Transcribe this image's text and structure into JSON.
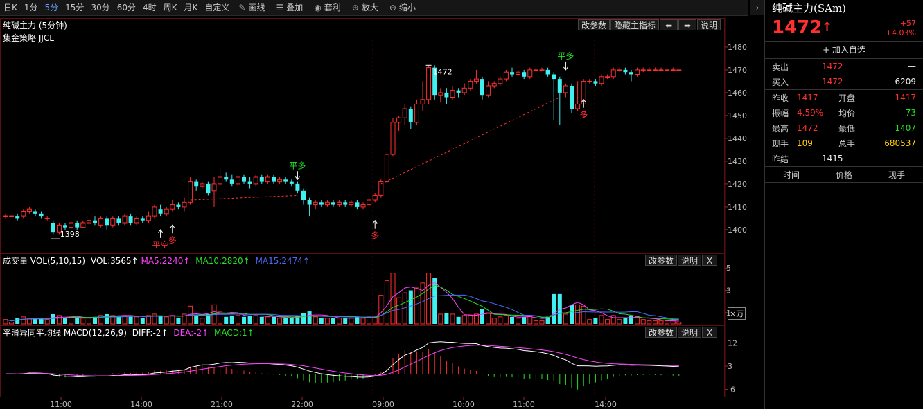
{
  "toolbar": {
    "timeframes": [
      "日K",
      "1分",
      "5分",
      "15分",
      "30分",
      "60分",
      "4时",
      "周K",
      "月K",
      "自定义"
    ],
    "active_timeframe": "5分",
    "tools": [
      {
        "label": "画线",
        "icon": "pencil-icon"
      },
      {
        "label": "叠加",
        "icon": "layers-icon"
      },
      {
        "label": "套利",
        "icon": "money-bag-icon"
      },
      {
        "label": "放大",
        "icon": "zoom-in-icon"
      },
      {
        "label": "缩小",
        "icon": "zoom-out-icon"
      }
    ]
  },
  "main_pane": {
    "title": "纯碱主力 (5分钟)",
    "strategy": "集金策略 JJCL",
    "buttons": {
      "params": "改参数",
      "hide": "隐藏主指标",
      "help": "说明"
    },
    "y_ticks": [
      "1480",
      "1470",
      "1460",
      "1450",
      "1440",
      "1430",
      "1420",
      "1410",
      "1400"
    ],
    "annotations": {
      "high": "1472",
      "low": "1398"
    },
    "signals": [
      {
        "text": "平空",
        "color": "#ff3030"
      },
      {
        "text": "多",
        "color": "#ff3030"
      },
      {
        "text": "平多",
        "color": "#22e022"
      },
      {
        "text": "多",
        "color": "#ff3030"
      },
      {
        "text": "平多",
        "color": "#22e022"
      },
      {
        "text": "多",
        "color": "#ff3030"
      }
    ]
  },
  "volume_pane": {
    "label": "成交量 VOL(5,10,15)",
    "vol": "VOL:3565↑",
    "ma5": "MA5:2240↑",
    "ma10": "MA10:2820↑",
    "ma15": "MA15:2474↑",
    "buttons": {
      "params": "改参数",
      "help": "说明",
      "close": "X"
    },
    "y_ticks": [
      "5",
      "3",
      "1"
    ],
    "unit": "×万"
  },
  "macd_pane": {
    "label": "平滑异同平均线 MACD(12,26,9)",
    "diff": "DIFF:-2↑",
    "dea": "DEA:-2↑",
    "macd": "MACD:1↑",
    "buttons": {
      "params": "改参数",
      "help": "说明",
      "close": "X"
    },
    "y_ticks": [
      "12",
      "3",
      "-6"
    ]
  },
  "x_axis": [
    "11:00",
    "14:00",
    "21:00",
    "22:00",
    "09:00",
    "10:00",
    "11:00",
    "14:00"
  ],
  "chart_data": {
    "type": "candlestick",
    "ylim": [
      1393,
      1483
    ],
    "candles": [
      [
        1406,
        1406,
        1407,
        1405
      ],
      [
        1406,
        1406,
        1406,
        1406
      ],
      [
        1406,
        1405,
        1407,
        1404
      ],
      [
        1406,
        1408,
        1409,
        1405
      ],
      [
        1408,
        1409,
        1410,
        1407
      ],
      [
        1408,
        1407,
        1409,
        1406
      ],
      [
        1407,
        1406,
        1408,
        1405
      ],
      [
        1405,
        1405,
        1406,
        1404
      ],
      [
        1403,
        1399,
        1404,
        1398
      ],
      [
        1399,
        1402,
        1403,
        1398
      ],
      [
        1402,
        1401,
        1403,
        1400
      ],
      [
        1401,
        1403,
        1404,
        1400
      ],
      [
        1403,
        1401,
        1404,
        1400
      ],
      [
        1401,
        1403,
        1404,
        1401
      ],
      [
        1403,
        1404,
        1405,
        1402
      ],
      [
        1404,
        1403,
        1406,
        1402
      ],
      [
        1402,
        1405,
        1406,
        1401
      ],
      [
        1405,
        1402,
        1406,
        1400
      ],
      [
        1402,
        1405,
        1406,
        1401
      ],
      [
        1405,
        1403,
        1406,
        1402
      ],
      [
        1403,
        1406,
        1407,
        1402
      ],
      [
        1406,
        1403,
        1407,
        1402
      ],
      [
        1403,
        1405,
        1406,
        1402
      ],
      [
        1405,
        1404,
        1406,
        1403
      ],
      [
        1404,
        1406,
        1408,
        1403
      ],
      [
        1406,
        1410,
        1411,
        1405
      ],
      [
        1409,
        1407,
        1411,
        1406
      ],
      [
        1407,
        1409,
        1410,
        1406
      ],
      [
        1409,
        1411,
        1413,
        1408
      ],
      [
        1411,
        1410,
        1412,
        1409
      ],
      [
        1410,
        1412,
        1414,
        1408
      ],
      [
        1412,
        1421,
        1423,
        1411
      ],
      [
        1421,
        1419,
        1422,
        1417
      ],
      [
        1419,
        1420,
        1421,
        1418
      ],
      [
        1420,
        1416,
        1421,
        1415
      ],
      [
        1417,
        1420,
        1423,
        1410
      ],
      [
        1420,
        1423,
        1427,
        1419
      ],
      [
        1423,
        1422,
        1425,
        1421
      ],
      [
        1422,
        1420,
        1424,
        1419
      ],
      [
        1420,
        1423,
        1424,
        1419
      ],
      [
        1423,
        1421,
        1424,
        1420
      ],
      [
        1421,
        1420,
        1423,
        1418
      ],
      [
        1420,
        1423,
        1424,
        1419
      ],
      [
        1423,
        1421,
        1424,
        1420
      ],
      [
        1421,
        1423,
        1424,
        1420
      ],
      [
        1423,
        1421,
        1424,
        1420
      ],
      [
        1421,
        1422,
        1423,
        1420
      ],
      [
        1422,
        1421,
        1423,
        1420
      ],
      [
        1421,
        1420,
        1422,
        1419
      ],
      [
        1420,
        1417,
        1421,
        1416
      ],
      [
        1417,
        1413,
        1418,
        1411
      ],
      [
        1413,
        1411,
        1414,
        1406
      ],
      [
        1411,
        1412,
        1413,
        1409
      ],
      [
        1412,
        1411,
        1413,
        1410
      ],
      [
        1411,
        1412,
        1413,
        1410
      ],
      [
        1412,
        1411,
        1413,
        1410
      ],
      [
        1411,
        1412,
        1413,
        1410
      ],
      [
        1412,
        1411,
        1413,
        1410
      ],
      [
        1411,
        1412,
        1413,
        1410
      ],
      [
        1412,
        1410,
        1413,
        1409
      ],
      [
        1410,
        1411,
        1412,
        1409
      ],
      [
        1411,
        1413,
        1414,
        1410
      ],
      [
        1413,
        1415,
        1416,
        1412
      ],
      [
        1415,
        1421,
        1422,
        1414
      ],
      [
        1421,
        1433,
        1434,
        1420
      ],
      [
        1433,
        1447,
        1449,
        1432
      ],
      [
        1447,
        1449,
        1450,
        1443
      ],
      [
        1449,
        1453,
        1455,
        1446
      ],
      [
        1453,
        1447,
        1454,
        1444
      ],
      [
        1447,
        1455,
        1457,
        1446
      ],
      [
        1455,
        1457,
        1465,
        1452
      ],
      [
        1457,
        1471,
        1472,
        1455
      ],
      [
        1471,
        1459,
        1472,
        1457
      ],
      [
        1459,
        1460,
        1462,
        1456
      ],
      [
        1460,
        1458,
        1462,
        1455
      ],
      [
        1458,
        1461,
        1463,
        1457
      ],
      [
        1461,
        1460,
        1462,
        1458
      ],
      [
        1460,
        1462,
        1464,
        1459
      ],
      [
        1462,
        1465,
        1466,
        1461
      ],
      [
        1465,
        1466,
        1470,
        1464
      ],
      [
        1466,
        1459,
        1467,
        1457
      ],
      [
        1459,
        1463,
        1465,
        1458
      ],
      [
        1463,
        1464,
        1465,
        1462
      ],
      [
        1464,
        1466,
        1467,
        1463
      ],
      [
        1466,
        1469,
        1470,
        1465
      ],
      [
        1469,
        1468,
        1471,
        1467
      ],
      [
        1468,
        1469,
        1470,
        1467
      ],
      [
        1469,
        1467,
        1470,
        1466
      ],
      [
        1467,
        1470,
        1471,
        1466
      ],
      [
        1470,
        1470,
        1471,
        1470
      ],
      [
        1470,
        1470,
        1471,
        1470
      ],
      [
        1470,
        1468,
        1471,
        1467
      ],
      [
        1468,
        1466,
        1469,
        1448
      ],
      [
        1466,
        1460,
        1467,
        1446
      ],
      [
        1460,
        1463,
        1464,
        1458
      ],
      [
        1463,
        1453,
        1464,
        1451
      ],
      [
        1453,
        1455,
        1465,
        1452
      ],
      [
        1455,
        1465,
        1466,
        1454
      ],
      [
        1465,
        1465,
        1466,
        1464
      ],
      [
        1465,
        1464,
        1466,
        1463
      ],
      [
        1464,
        1467,
        1468,
        1463
      ],
      [
        1467,
        1467,
        1468,
        1466
      ],
      [
        1467,
        1470,
        1471,
        1466
      ],
      [
        1470,
        1470,
        1471,
        1469
      ],
      [
        1470,
        1469,
        1471,
        1468
      ],
      [
        1469,
        1468,
        1470,
        1465
      ],
      [
        1468,
        1470,
        1471,
        1467
      ],
      [
        1470,
        1470,
        1471,
        1469
      ],
      [
        1470,
        1470,
        1471,
        1470
      ],
      [
        1470,
        1470,
        1471,
        1470
      ],
      [
        1470,
        1470,
        1471,
        1470
      ],
      [
        1470,
        1470,
        1471,
        1470
      ],
      [
        1470,
        1470,
        1471,
        1470
      ],
      [
        1470,
        1470,
        1470,
        1470
      ]
    ]
  },
  "side": {
    "title": "纯碱主力(SAm)",
    "price": "1472",
    "change": "+57",
    "change_pct": "+4.03%",
    "watch_button": "+ 加入自选",
    "sell": {
      "label": "卖出",
      "price": "1472",
      "vol": "—"
    },
    "buy": {
      "label": "买入",
      "price": "1472",
      "vol": "6209"
    },
    "stats": [
      {
        "l1": "昨收",
        "v1": "1417",
        "c1": "red",
        "l2": "开盘",
        "v2": "1417",
        "c2": "red"
      },
      {
        "l1": "振幅",
        "v1": "4.59%",
        "c1": "red",
        "l2": "均价",
        "v2": "73",
        "c2": "green"
      },
      {
        "l1": "最高",
        "v1": "1472",
        "c1": "red",
        "l2": "最低",
        "v2": "1407",
        "c2": "green"
      },
      {
        "l1": "现手",
        "v1": "109",
        "c1": "yellow",
        "l2": "总手",
        "v2": "680537",
        "c2": "yellow"
      }
    ],
    "settle": {
      "label": "昨结",
      "value": "1415"
    },
    "tape_headers": [
      "时间",
      "价格",
      "现手"
    ]
  }
}
